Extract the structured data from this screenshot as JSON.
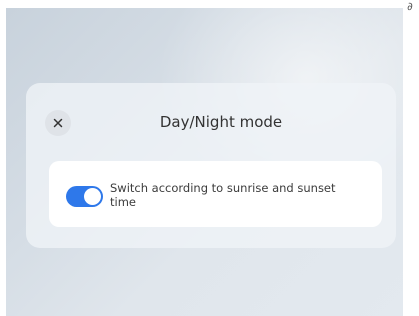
{
  "dialog": {
    "title": "Day/Night mode",
    "close_icon": "close-icon"
  },
  "option": {
    "label": "Switch according to sunrise and sunset time",
    "enabled": true,
    "accent_color": "#2e78ea"
  },
  "corner": {
    "icon": "settings-icon"
  }
}
